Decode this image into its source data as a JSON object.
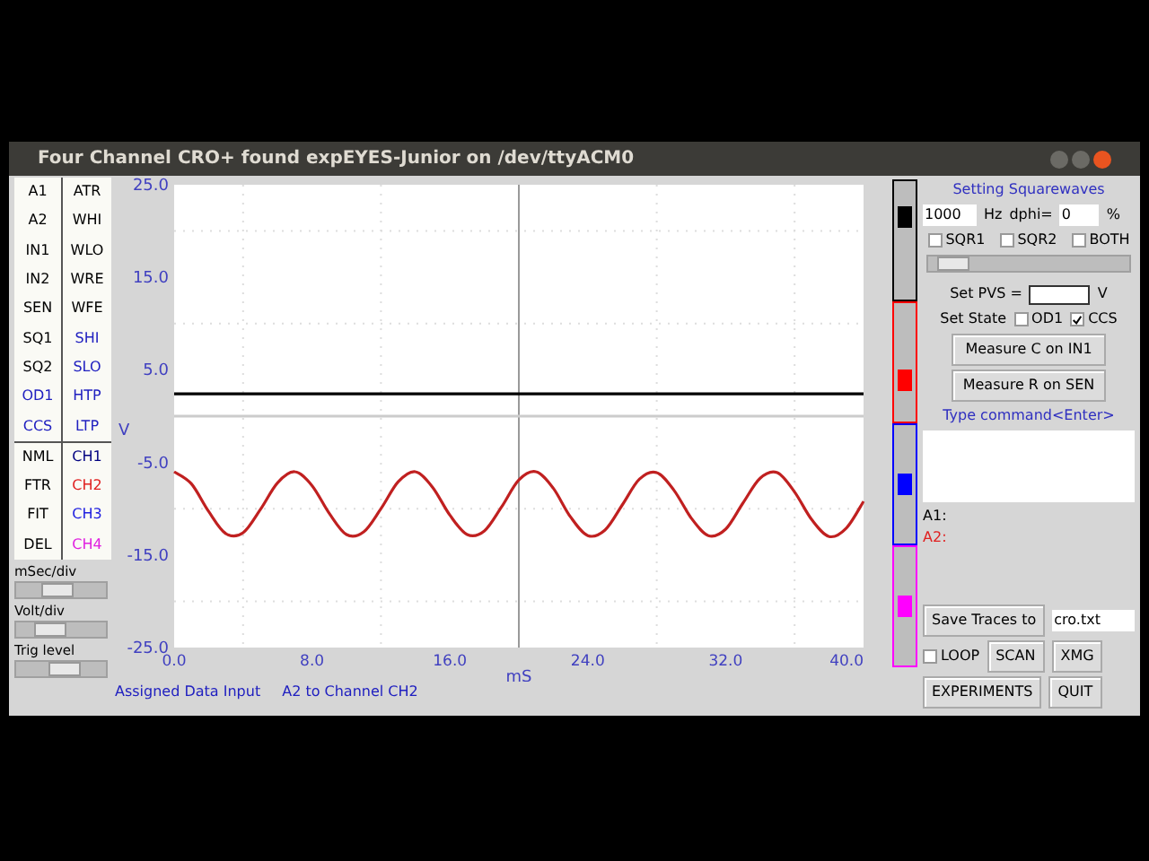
{
  "window": {
    "title": "Four Channel CRO+ found expEYES-Junior on /dev/ttyACM0"
  },
  "left_buttons": [
    {
      "label": "A1",
      "color": "#000000"
    },
    {
      "label": "ATR",
      "color": "#000000"
    },
    {
      "label": "A2",
      "color": "#000000"
    },
    {
      "label": "WHI",
      "color": "#000000"
    },
    {
      "label": "IN1",
      "color": "#000000"
    },
    {
      "label": "WLO",
      "color": "#000000"
    },
    {
      "label": "IN2",
      "color": "#000000"
    },
    {
      "label": "WRE",
      "color": "#000000"
    },
    {
      "label": "SEN",
      "color": "#000000"
    },
    {
      "label": "WFE",
      "color": "#000000"
    },
    {
      "label": "SQ1",
      "color": "#000000"
    },
    {
      "label": "SHI",
      "color": "#2020c0"
    },
    {
      "label": "SQ2",
      "color": "#000000"
    },
    {
      "label": "SLO",
      "color": "#2020c0"
    },
    {
      "label": "OD1",
      "color": "#2020c0"
    },
    {
      "label": "HTP",
      "color": "#2020c0"
    },
    {
      "label": "CCS",
      "color": "#2020c0"
    },
    {
      "label": "LTP",
      "color": "#2020c0"
    }
  ],
  "mode_buttons": [
    {
      "label": "NML",
      "color": "#000000"
    },
    {
      "label": "CH1",
      "color": "#000080"
    },
    {
      "label": "FTR",
      "color": "#000000"
    },
    {
      "label": "CH2",
      "color": "#e02020"
    },
    {
      "label": "FIT",
      "color": "#000000"
    },
    {
      "label": "CH3",
      "color": "#2020e0"
    },
    {
      "label": "DEL",
      "color": "#000000"
    },
    {
      "label": "CH4",
      "color": "#e020e0"
    }
  ],
  "sliders": [
    {
      "label": "mSec/div",
      "level": 0.45
    },
    {
      "label": "Volt/div",
      "level": 0.3
    },
    {
      "label": "Trig level",
      "level": 0.55
    }
  ],
  "plot": {
    "chart_data": {
      "type": "line",
      "xlabel": "mS",
      "ylabel": "V",
      "x": [
        0,
        1,
        2,
        3,
        4,
        5,
        6,
        7,
        8,
        9,
        10,
        11,
        12,
        13,
        14,
        15,
        16,
        17,
        18,
        19,
        20,
        21,
        22,
        23,
        24,
        25,
        26,
        27,
        28,
        29,
        30,
        31,
        32,
        33,
        34,
        35,
        36,
        37,
        38,
        39,
        40
      ],
      "series": [
        {
          "color": "#000000",
          "values": [
            2.4,
            2.4,
            2.4,
            2.4,
            2.4,
            2.4,
            2.4,
            2.4,
            2.4,
            2.4,
            2.4,
            2.4,
            2.4,
            2.4,
            2.4,
            2.4,
            2.4,
            2.4,
            2.4,
            2.4,
            2.4,
            2.4,
            2.4,
            2.4,
            2.4,
            2.4,
            2.4,
            2.4,
            2.4,
            2.4,
            2.4,
            2.4,
            2.4,
            2.4,
            2.4,
            2.4,
            2.4,
            2.4,
            2.4,
            2.4,
            2.4
          ]
        },
        {
          "color": "#c02020",
          "values": [
            -6.0,
            -7.3,
            -10.3,
            -12.7,
            -12.6,
            -10.1,
            -7.2,
            -6.0,
            -7.5,
            -10.5,
            -12.8,
            -12.5,
            -10.0,
            -7.1,
            -6.0,
            -7.7,
            -10.7,
            -12.8,
            -12.4,
            -9.8,
            -6.9,
            -6.0,
            -7.8,
            -10.9,
            -12.9,
            -12.3,
            -9.6,
            -6.8,
            -6.1,
            -8.0,
            -11.0,
            -12.9,
            -12.2,
            -9.4,
            -6.7,
            -6.1,
            -8.2,
            -11.2,
            -13.0,
            -12.1,
            -9.2
          ]
        }
      ],
      "ref_lines": [
        {
          "axis": "x",
          "value": 20
        }
      ],
      "xlim": [
        0,
        40
      ],
      "ylim": [
        -25,
        25
      ],
      "xticks": [
        {
          "value": 0,
          "label": "0.0"
        },
        {
          "value": 8,
          "label": "8.0"
        },
        {
          "value": 16,
          "label": "16.0"
        },
        {
          "value": 24,
          "label": "24.0"
        },
        {
          "value": 32,
          "label": "32.0"
        },
        {
          "value": 40,
          "label": "40.0"
        }
      ],
      "yticks": [
        {
          "value": 25,
          "label": "25.0"
        },
        {
          "value": 15,
          "label": "15.0"
        },
        {
          "value": 5,
          "label": "5.0"
        },
        {
          "value": -5,
          "label": "-5.0"
        },
        {
          "value": -15,
          "label": "-15.0"
        },
        {
          "value": -25,
          "label": "-25.0"
        }
      ]
    }
  },
  "offset_sliders": [
    {
      "color": "#000000",
      "level": 0.7
    },
    {
      "color": "#ff0000",
      "level": 0.35
    },
    {
      "color": "#0000ff",
      "level": 0.5
    },
    {
      "color": "#ff00ff",
      "level": 0.5
    }
  ],
  "status": [
    "Assigned Data Input",
    "A2 to Channel CH2"
  ],
  "squarewave": {
    "title": "Setting Squarewaves",
    "frequency": "1000",
    "freq_unit": "Hz",
    "dphi_label": "dphi=",
    "dphi": "0",
    "percent": "%",
    "checkboxes": [
      {
        "label": "SQR1",
        "checked": false
      },
      {
        "label": "SQR2",
        "checked": false
      },
      {
        "label": "BOTH",
        "checked": false
      }
    ],
    "level": 0.05
  },
  "pvs": {
    "label": "Set PVS =",
    "unit": "V"
  },
  "set_state": {
    "label": "Set State",
    "checkboxes": [
      {
        "label": "OD1",
        "checked": false
      },
      {
        "label": "CCS",
        "checked": true
      }
    ]
  },
  "measure_buttons": [
    "Measure C on IN1",
    "Measure R on SEN"
  ],
  "command": {
    "label": "Type command<Enter>"
  },
  "readouts": [
    {
      "text": "A1:",
      "color": "#000000"
    },
    {
      "text": "A2:",
      "color": "#e02020"
    }
  ],
  "save": {
    "button": "Save Traces to",
    "value": "cro.txt"
  },
  "loop": {
    "label": "LOOP",
    "checked": false
  },
  "buttons": [
    "SCAN",
    "XMG",
    "EXPERIMENTS",
    "QUIT"
  ]
}
